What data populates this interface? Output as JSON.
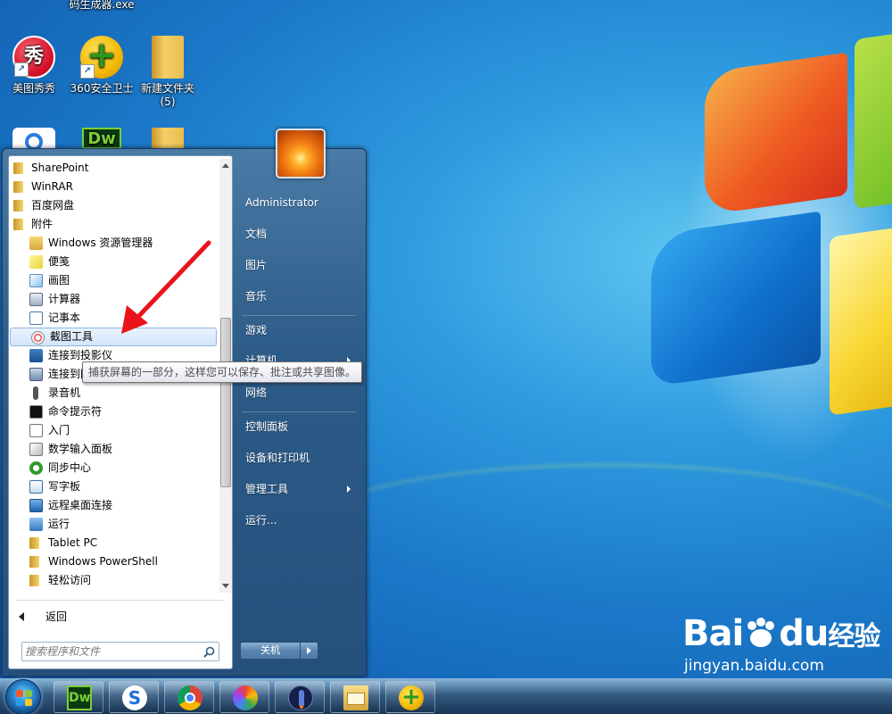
{
  "desktop": {
    "icons": [
      {
        "label": "美图秀秀",
        "glyph": "秀"
      },
      {
        "label": "360安全卫士",
        "glyph": "+"
      },
      {
        "label": "新建文件夹\n(5)"
      },
      {
        "label": "码生成器.exe"
      },
      {
        "label": "",
        "glyph": "Dw"
      }
    ]
  },
  "start_menu": {
    "programs": [
      {
        "label": "SharePoint"
      },
      {
        "label": "WinRAR"
      },
      {
        "label": "百度网盘"
      },
      {
        "label": "附件"
      },
      {
        "label": "Windows 资源管理器"
      },
      {
        "label": "便笺"
      },
      {
        "label": "画图"
      },
      {
        "label": "计算器"
      },
      {
        "label": "记事本"
      },
      {
        "label": "截图工具"
      },
      {
        "label": "连接到投影仪"
      },
      {
        "label": "连接到网络投影仪"
      },
      {
        "label": "录音机"
      },
      {
        "label": "命令提示符"
      },
      {
        "label": "入门"
      },
      {
        "label": "数学输入面板"
      },
      {
        "label": "同步中心"
      },
      {
        "label": "写字板"
      },
      {
        "label": "远程桌面连接"
      },
      {
        "label": "运行"
      },
      {
        "label": "Tablet PC"
      },
      {
        "label": "Windows PowerShell"
      },
      {
        "label": "轻松访问"
      }
    ],
    "back_label": "返回",
    "search_placeholder": "搜索程序和文件",
    "right_items": [
      {
        "label": "Administrator"
      },
      {
        "label": "文档"
      },
      {
        "label": "图片"
      },
      {
        "label": "音乐"
      },
      {
        "label": "游戏"
      },
      {
        "label": "计算机"
      },
      {
        "label": "网络"
      },
      {
        "label": "控制面板"
      },
      {
        "label": "设备和打印机"
      },
      {
        "label": "管理工具"
      },
      {
        "label": "运行..."
      }
    ],
    "shutdown_label": "关机",
    "tooltip": "捕获屏幕的一部分，这样您可以保存、批注或共享图像。"
  },
  "taskbar": {
    "pinned": [
      {
        "icon": "dreamweaver-icon",
        "glyph": "Dw"
      },
      {
        "icon": "sogou-browser-icon",
        "glyph": "S"
      },
      {
        "icon": "chrome-icon"
      },
      {
        "icon": "photos-icon"
      },
      {
        "icon": "rocket-icon"
      },
      {
        "icon": "explorer-icon"
      },
      {
        "icon": "360-icon",
        "glyph": "+"
      }
    ]
  },
  "watermark": {
    "brand": "Bai",
    "brand2": "du",
    "suffix": "经验",
    "site": "jingyan.baidu.com"
  }
}
